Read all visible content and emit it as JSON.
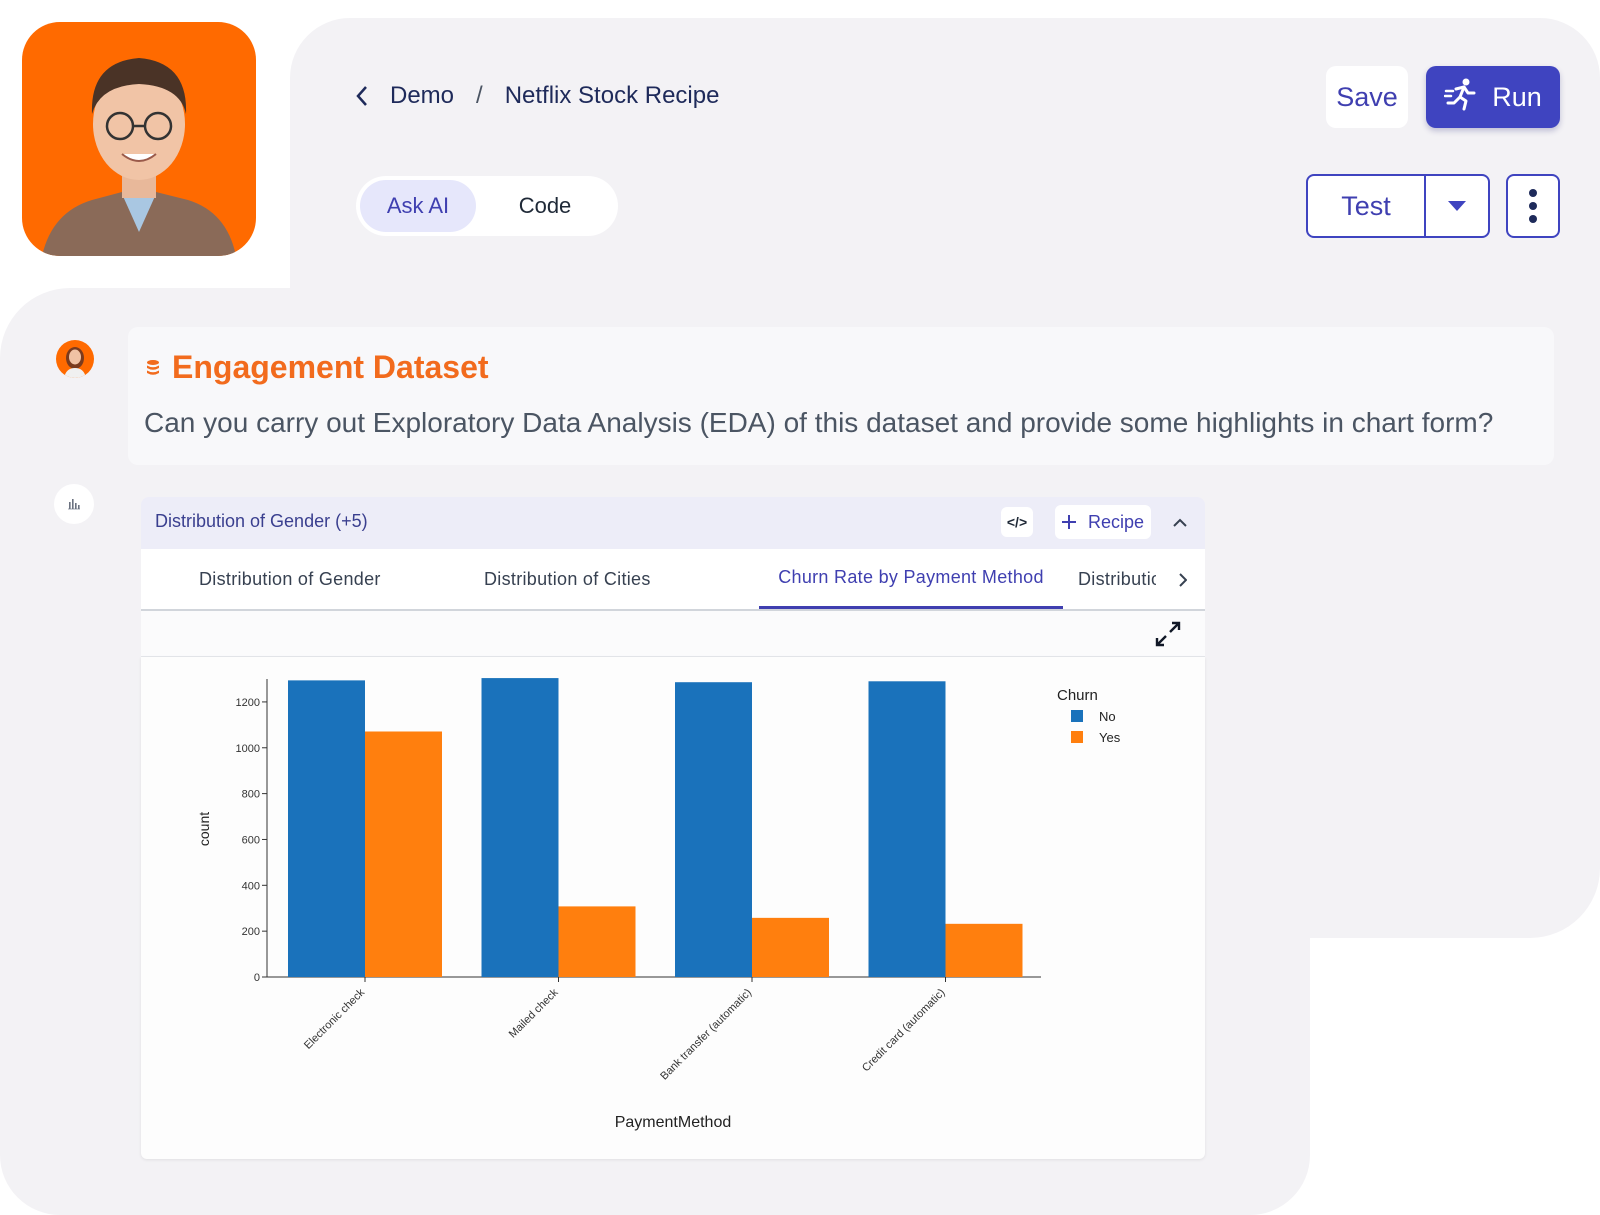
{
  "header": {
    "breadcrumb": {
      "parent": "Demo",
      "separator": "/",
      "current": "Netflix Stock Recipe"
    },
    "save_label": "Save",
    "run_label": "Run",
    "test_label": "Test"
  },
  "mode_toggle": {
    "ask_ai": "Ask AI",
    "code": "Code"
  },
  "message": {
    "dataset_title": "Engagement Dataset",
    "text": "Can you carry out Exploratory Data Analysis (EDA) of this dataset and provide some highlights in chart form?"
  },
  "result": {
    "title": "Distribution of Gender (+5)",
    "code_label": "</>",
    "recipe_label": "Recipe",
    "tabs": [
      {
        "label": "Distribution of Gender"
      },
      {
        "label": "Distribution of Cities"
      },
      {
        "label": "Churn Rate by Payment Method"
      },
      {
        "label": "Distribution of Churn"
      }
    ]
  },
  "colors": {
    "accent": "#3f44c0",
    "brand_orange": "#f26b1d",
    "series_no": "#1a72bb",
    "series_yes": "#ff7f0e"
  },
  "chart_data": {
    "type": "bar",
    "xlabel": "PaymentMethod",
    "ylabel": "count",
    "ylim": [
      0,
      1300
    ],
    "yticks": [
      0,
      200,
      400,
      600,
      800,
      1000,
      1200
    ],
    "categories": [
      "Electronic check",
      "Mailed check",
      "Bank transfer (automatic)",
      "Credit card (automatic)"
    ],
    "legend_title": "Churn",
    "legend_position": "top-right",
    "grid": false,
    "series": [
      {
        "name": "No",
        "color": "#1a72bb",
        "values": [
          1294,
          1304,
          1286,
          1290
        ]
      },
      {
        "name": "Yes",
        "color": "#ff7f0e",
        "values": [
          1071,
          308,
          258,
          232
        ]
      }
    ]
  }
}
